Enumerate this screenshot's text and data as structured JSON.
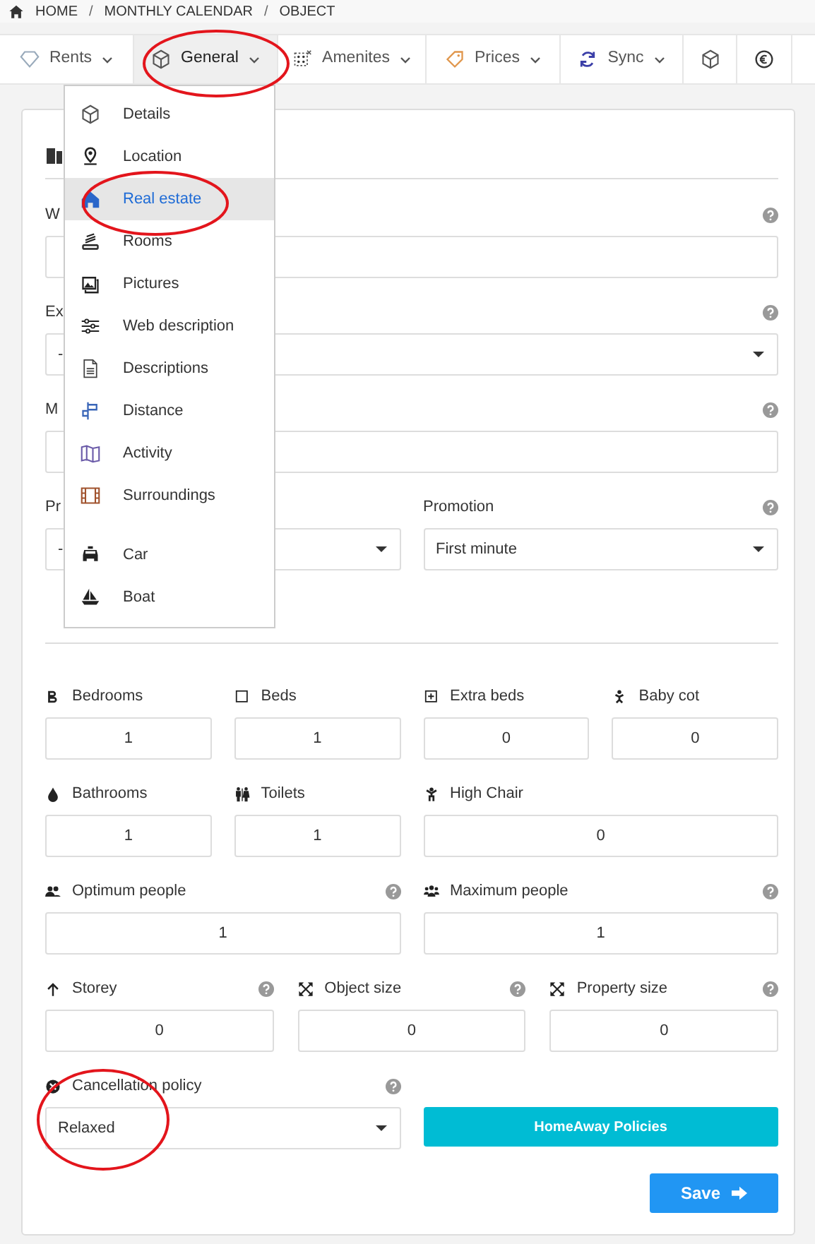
{
  "breadcrumb": {
    "separator": "/",
    "items": [
      "HOME",
      "MONTHLY CALENDAR",
      "OBJECT"
    ]
  },
  "nav_tabs": [
    {
      "label": "Rents",
      "selected": false
    },
    {
      "label": "General",
      "selected": true
    },
    {
      "label": "Amenites",
      "selected": false
    },
    {
      "label": "Prices",
      "selected": false
    },
    {
      "label": "Sync",
      "selected": false
    },
    {
      "selected": false
    },
    {
      "selected": false
    }
  ],
  "menu": {
    "groups": [
      [
        {
          "label": "Details",
          "selected": false
        },
        {
          "label": "Location",
          "selected": false
        },
        {
          "label": "Real estate",
          "selected": true
        },
        {
          "label": "Rooms",
          "selected": false
        },
        {
          "label": "Pictures",
          "selected": false
        },
        {
          "label": "Web description",
          "selected": false
        },
        {
          "label": "Descriptions",
          "selected": false
        },
        {
          "label": "Distance",
          "selected": false
        },
        {
          "label": "Activity",
          "selected": false
        },
        {
          "label": "Surroundings",
          "selected": false
        }
      ],
      [
        {
          "label": "Car",
          "selected": false
        },
        {
          "label": "Boat",
          "selected": false
        }
      ]
    ]
  },
  "sections": [
    {
      "rows": [
        {
          "fields": [
            {
              "label": "W",
              "help": true,
              "kind": "input"
            }
          ]
        },
        {
          "fields": [
            {
              "label": "Ex",
              "help": true,
              "kind": "select",
              "value": "-"
            }
          ]
        },
        {
          "fields": [
            {
              "label": "M",
              "help": true,
              "kind": "input"
            }
          ]
        },
        {
          "fields": [
            {
              "label": "Pr",
              "help": false,
              "kind": "select",
              "value": "-"
            },
            {
              "label": "Promotion",
              "help": true,
              "kind": "select",
              "value": "First minute"
            }
          ]
        }
      ]
    },
    {
      "rows": [
        {
          "fields": [
            {
              "label": "Bedrooms",
              "help": false,
              "kind": "number",
              "value": "1"
            },
            {
              "label": "Beds",
              "help": false,
              "kind": "number",
              "value": "1"
            },
            {
              "label": "Extra beds",
              "help": false,
              "kind": "number",
              "value": "0"
            },
            {
              "label": "Baby cot",
              "help": false,
              "kind": "number",
              "value": "0"
            }
          ]
        },
        {
          "fields": [
            {
              "label": "Bathrooms",
              "help": false,
              "kind": "number",
              "value": "1"
            },
            {
              "label": "Toilets",
              "help": false,
              "kind": "number",
              "value": "1"
            },
            {
              "label": "High Chair",
              "help": false,
              "kind": "number",
              "value": "0",
              "wide": true
            }
          ]
        },
        {
          "fields": [
            {
              "label": "Optimum people",
              "help": true,
              "kind": "number",
              "value": "1"
            },
            {
              "label": "Maximum people",
              "help": true,
              "kind": "number",
              "value": "1"
            }
          ]
        },
        {
          "fields": [
            {
              "label": "Storey",
              "help": true,
              "kind": "number",
              "value": "0"
            },
            {
              "label": "Object size",
              "help": true,
              "kind": "number",
              "value": "0"
            },
            {
              "label": "Property size",
              "help": true,
              "kind": "number",
              "value": "0"
            }
          ]
        },
        {
          "fields": [
            {
              "label": "Cancellation policy",
              "help": true,
              "kind": "select",
              "value": "Relaxed"
            },
            {
              "label": "HomeAway Policies",
              "kind": "button"
            }
          ]
        }
      ]
    }
  ],
  "save": {
    "label": "Save"
  }
}
